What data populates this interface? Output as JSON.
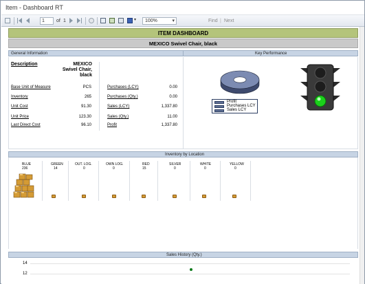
{
  "window": {
    "title": "Item - Dashboard RT"
  },
  "toolbar": {
    "page_current": "1",
    "page_of_label": "of",
    "page_total": "1",
    "zoom": "100%",
    "find_label": "Find",
    "next_label": "Next"
  },
  "report": {
    "title": "ITEM DASHBOARD",
    "subtitle": "MEXICO Swivel Chair, black"
  },
  "general_info": {
    "header": "General Information",
    "description_label": "Description",
    "description_value": "MEXICO Swivel Chair, black",
    "left_rows": [
      {
        "label": "Base Unit of Measure",
        "value": "PCS"
      },
      {
        "label": "Inventory",
        "value": "265"
      },
      {
        "label": "Unit Cost",
        "value": "91.30"
      },
      {
        "label": "Unit Price",
        "value": "123.30"
      },
      {
        "label": "Last Direct Cost",
        "value": "96.10"
      }
    ],
    "right_rows": [
      {
        "label": "Purchases (LCY)",
        "value": "0.00"
      },
      {
        "label": "Purchases (Qty.)",
        "value": "0.00"
      },
      {
        "label": "Sales (LCY)",
        "value": "1,337.80"
      },
      {
        "label": "Sales (Qty.)",
        "value": "11.00"
      },
      {
        "label": "Profit",
        "value": "1,337.80"
      }
    ]
  },
  "key_performance": {
    "header": "Key Performance",
    "legend": [
      "Profit",
      "Purchases LCY",
      "Sales LCY"
    ],
    "traffic_light_state": "green"
  },
  "inventory": {
    "header": "Inventory by Location",
    "locations": [
      {
        "name": "BLUE",
        "qty": "236"
      },
      {
        "name": "GREEN",
        "qty": "14"
      },
      {
        "name": "OUT. LOG.",
        "qty": "0"
      },
      {
        "name": "OWN LOG.",
        "qty": "0"
      },
      {
        "name": "RED",
        "qty": "15"
      },
      {
        "name": "SILVER",
        "qty": "0"
      },
      {
        "name": "WHITE",
        "qty": "0"
      },
      {
        "name": "YELLOW",
        "qty": "0"
      }
    ]
  },
  "sales_history": {
    "header": "Sales History (Qty.)",
    "y_ticks": [
      "14",
      "12"
    ]
  },
  "colors": {
    "title_green": "#b4c47b",
    "section_blue": "#c7d4e4",
    "subtitle_gray": "#c9c9c9",
    "light_green": "#1bd11b"
  }
}
